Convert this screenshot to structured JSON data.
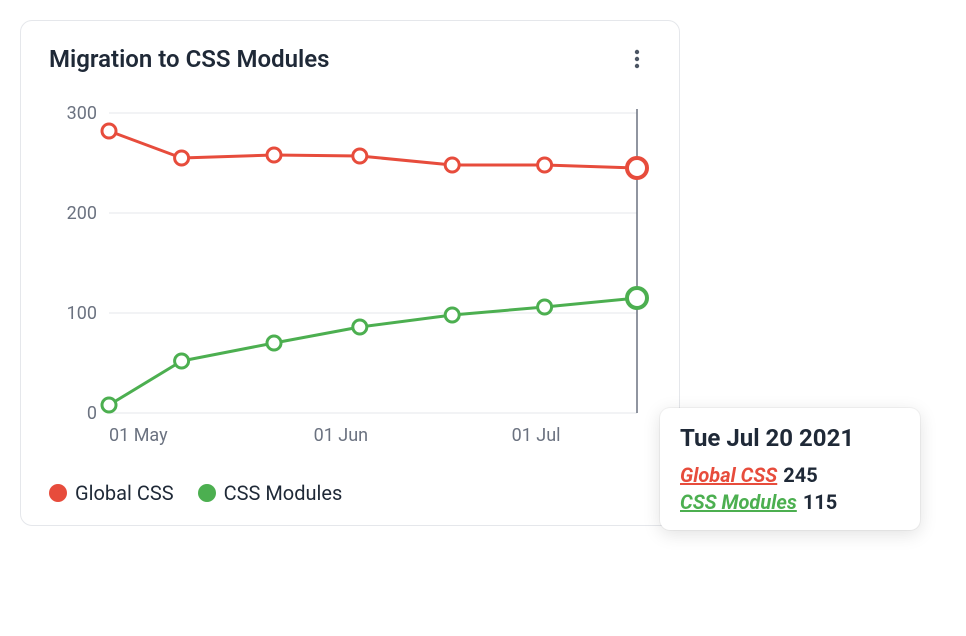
{
  "card": {
    "title": "Migration to CSS Modules"
  },
  "legend": [
    {
      "name": "Global CSS",
      "color": "#e74c3c"
    },
    {
      "name": "CSS Modules",
      "color": "#4caf50"
    }
  ],
  "tooltip": {
    "date": "Tue Jul 20 2021",
    "rows": [
      {
        "label": "Global CSS",
        "value": "245",
        "color": "#e74c3c"
      },
      {
        "label": "CSS Modules",
        "value": "115",
        "color": "#4caf50"
      }
    ]
  },
  "chart_data": {
    "type": "line",
    "title": "Migration to CSS Modules",
    "xlabel": "",
    "ylabel": "",
    "ylim": [
      0,
      300
    ],
    "y_ticks": [
      0,
      100,
      200,
      300
    ],
    "x_tick_labels": [
      "01 May",
      "01 Jun",
      "01 Jul"
    ],
    "x_dates": [
      "2021-05-01",
      "2021-05-12",
      "2021-05-26",
      "2021-06-08",
      "2021-06-22",
      "2021-07-06",
      "2021-07-20"
    ],
    "series": [
      {
        "name": "Global CSS",
        "color": "#e74c3c",
        "values": [
          282,
          255,
          258,
          257,
          248,
          248,
          245
        ]
      },
      {
        "name": "CSS Modules",
        "color": "#4caf50",
        "values": [
          8,
          52,
          70,
          86,
          98,
          106,
          115
        ]
      }
    ],
    "highlight_index": 6
  }
}
